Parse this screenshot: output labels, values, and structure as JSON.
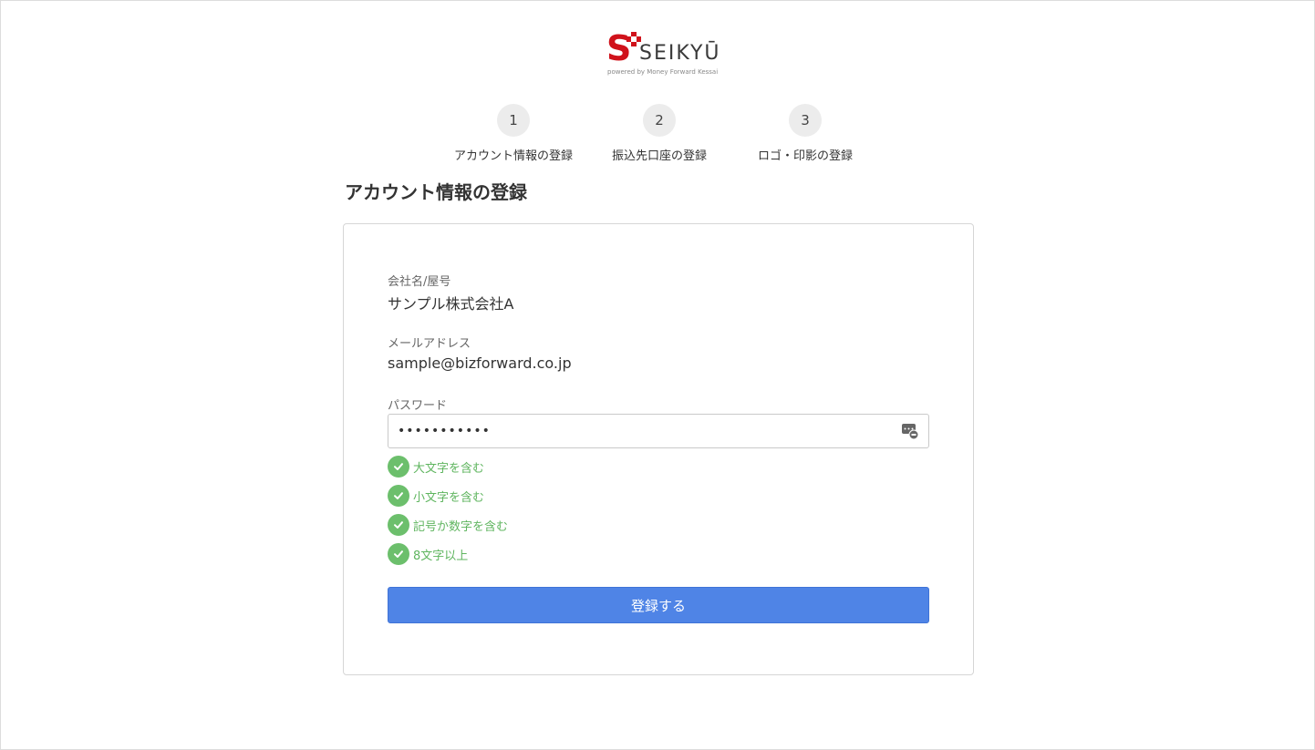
{
  "logo": {
    "mark": "S",
    "word": "SEIKYŪ",
    "sub": "powered by Money Forward Kessai",
    "brand_color": "#d0121b"
  },
  "steps": [
    {
      "number": "1",
      "label": "アカウント情報の登録"
    },
    {
      "number": "2",
      "label": "振込先口座の登録"
    },
    {
      "number": "3",
      "label": "ロゴ・印影の登録"
    }
  ],
  "page": {
    "title": "アカウント情報の登録"
  },
  "form": {
    "company_label": "会社名/屋号",
    "company_value": "サンプル株式会社A",
    "email_label": "メールアドレス",
    "email_value": "sample@bizforward.co.jp",
    "password_label": "パスワード",
    "password_value": "•••••••••••",
    "password_icon": "password-visibility-icon",
    "rules": [
      {
        "text": "大文字を含む",
        "ok": true
      },
      {
        "text": "小文字を含む",
        "ok": true
      },
      {
        "text": "記号か数字を含む",
        "ok": true
      },
      {
        "text": "8文字以上",
        "ok": true
      }
    ],
    "rule_color": "#6cbf6c",
    "submit_label": "登録する",
    "submit_color": "#4f84e6"
  }
}
